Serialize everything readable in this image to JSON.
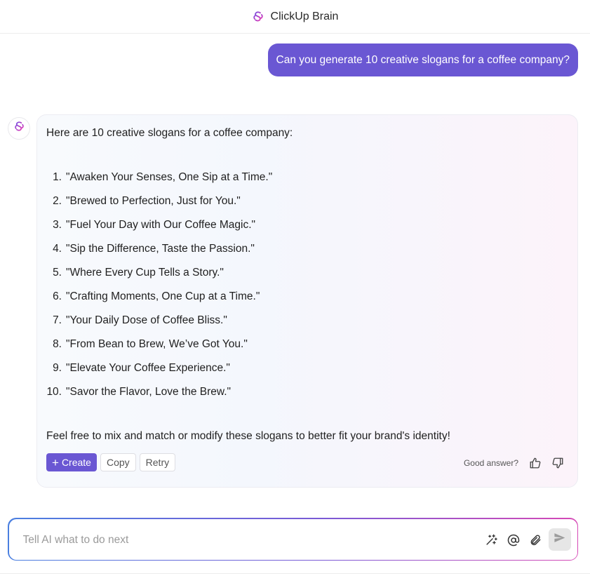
{
  "header": {
    "title": "ClickUp Brain",
    "logo_icon": "clickup-brain-logo-icon"
  },
  "user_message": "Can you generate 10 creative slogans for a coffee company?",
  "ai_response": {
    "intro": "Here are 10 creative slogans for a coffee company:",
    "items": [
      {
        "num": "1.",
        "text": "\"Awaken Your Senses, One Sip at a Time.\""
      },
      {
        "num": "2.",
        "text": "\"Brewed to Perfection, Just for You.\""
      },
      {
        "num": "3.",
        "text": "\"Fuel Your Day with Our Coffee Magic.\""
      },
      {
        "num": "4.",
        "text": "\"Sip the Difference, Taste the Passion.\""
      },
      {
        "num": "5.",
        "text": "\"Where Every Cup Tells a Story.\""
      },
      {
        "num": "6.",
        "text": "\"Crafting Moments, One Cup at a Time.\""
      },
      {
        "num": "7.",
        "text": "\"Your Daily Dose of Coffee Bliss.\""
      },
      {
        "num": "8.",
        "text": "\"From Bean to Brew, We’ve Got You.\""
      },
      {
        "num": "9.",
        "text": "\"Elevate Your Coffee Experience.\""
      },
      {
        "num": "10.",
        "text": "\"Savor the Flavor, Love the Brew.\""
      }
    ],
    "outro": "Feel free to mix and match or modify these slogans to better fit your brand's identity!"
  },
  "actions": {
    "create_label": "Create",
    "copy_label": "Copy",
    "retry_label": "Retry"
  },
  "feedback": {
    "label": "Good answer?"
  },
  "composer": {
    "placeholder": "Tell AI what to do next"
  },
  "colors": {
    "accent": "#6a57d3",
    "brand_pink": "#d63fc7",
    "brand_purple": "#7b4fe0"
  }
}
